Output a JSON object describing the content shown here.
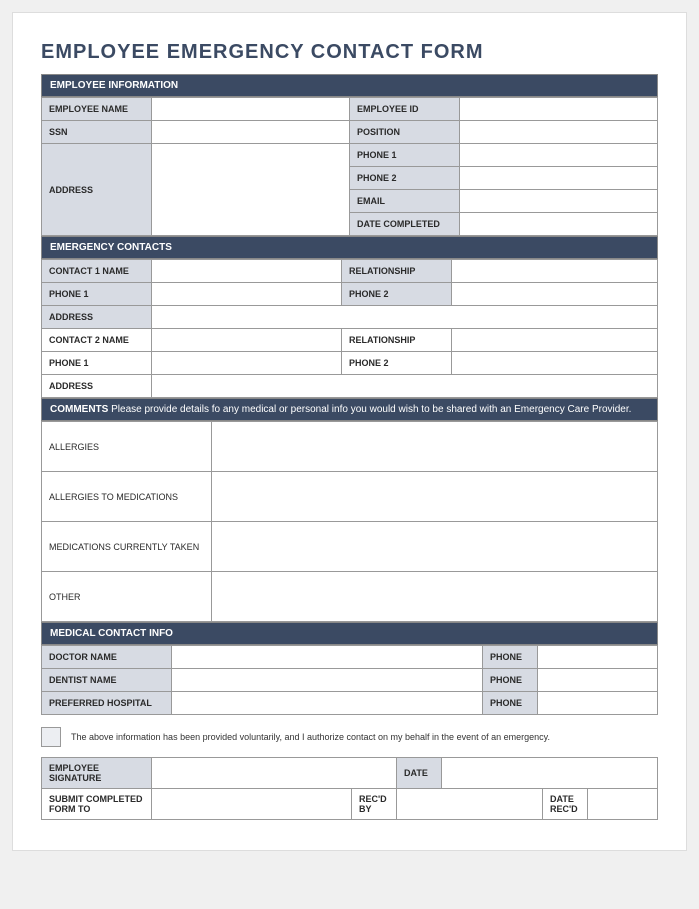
{
  "title": "EMPLOYEE EMERGENCY CONTACT FORM",
  "sections": {
    "employee_info": {
      "header": "EMPLOYEE INFORMATION",
      "labels": {
        "employee_name": "EMPLOYEE NAME",
        "employee_id": "EMPLOYEE ID",
        "ssn": "SSN",
        "position": "POSITION",
        "address": "ADDRESS",
        "phone1": "PHONE 1",
        "phone2": "PHONE 2",
        "email": "EMAIL",
        "date_completed": "DATE COMPLETED"
      },
      "values": {
        "employee_name": "",
        "employee_id": "",
        "ssn": "",
        "position": "",
        "address": "",
        "phone1": "",
        "phone2": "",
        "email": "",
        "date_completed": ""
      }
    },
    "emergency_contacts": {
      "header": "EMERGENCY CONTACTS",
      "labels": {
        "contact1_name": "CONTACT 1 NAME",
        "contact2_name": "CONTACT 2 NAME",
        "relationship": "RELATIONSHIP",
        "phone1": "PHONE 1",
        "phone2": "PHONE 2",
        "address": "ADDRESS"
      },
      "values": {
        "contact1_name": "",
        "contact1_relationship": "",
        "contact1_phone1": "",
        "contact1_phone2": "",
        "contact1_address": "",
        "contact2_name": "",
        "contact2_relationship": "",
        "contact2_phone1": "",
        "contact2_phone2": "",
        "contact2_address": ""
      }
    },
    "comments": {
      "header_bold": "COMMENTS",
      "header_text": " Please provide details fo any medical or personal info you would wish to be shared with an Emergency Care Provider.",
      "labels": {
        "allergies": "ALLERGIES",
        "allergies_meds": "ALLERGIES TO MEDICATIONS",
        "meds_taken": "MEDICATIONS CURRENTLY TAKEN",
        "other": "OTHER"
      },
      "values": {
        "allergies": "",
        "allergies_meds": "",
        "meds_taken": "",
        "other": ""
      }
    },
    "medical": {
      "header": "MEDICAL CONTACT INFO",
      "labels": {
        "doctor_name": "DOCTOR NAME",
        "dentist_name": "DENTIST NAME",
        "preferred_hospital": "PREFERRED HOSPITAL",
        "phone": "PHONE"
      },
      "values": {
        "doctor_name": "",
        "doctor_phone": "",
        "dentist_name": "",
        "dentist_phone": "",
        "preferred_hospital": "",
        "preferred_hospital_phone": ""
      }
    },
    "consent": {
      "text": "The above information has been provided voluntarily, and I authorize contact on my behalf in the event of an emergency."
    },
    "signature": {
      "labels": {
        "employee_signature": "EMPLOYEE SIGNATURE",
        "date": "DATE",
        "submit_to": "SUBMIT COMPLETED FORM TO",
        "recd_by": "REC'D BY",
        "date_recd": "DATE REC'D"
      },
      "values": {
        "employee_signature": "",
        "date": "",
        "submit_to": "",
        "recd_by": "",
        "date_recd": ""
      }
    }
  }
}
